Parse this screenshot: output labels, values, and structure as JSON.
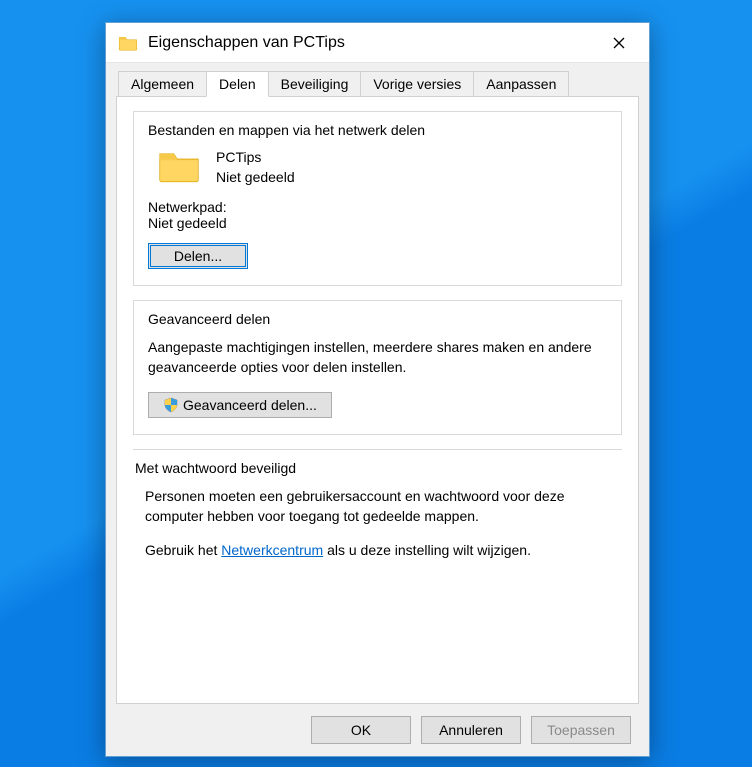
{
  "titlebar": {
    "title": "Eigenschappen van PCTips"
  },
  "tabs": {
    "algemeen": "Algemeen",
    "delen": "Delen",
    "beveiliging": "Beveiliging",
    "vorige": "Vorige versies",
    "aanpassen": "Aanpassen"
  },
  "section_share": {
    "heading": "Bestanden en mappen via het netwerk delen",
    "folder_name": "PCTips",
    "folder_status": "Niet gedeeld",
    "netpath_label": "Netwerkpad:",
    "netpath_value": "Niet gedeeld",
    "share_button": "Delen..."
  },
  "section_advanced": {
    "heading": "Geavanceerd delen",
    "description": "Aangepaste machtigingen instellen, meerdere shares maken en andere geavanceerde opties voor delen instellen.",
    "button": "Geavanceerd delen..."
  },
  "section_password": {
    "heading": "Met wachtwoord beveiligd",
    "line1": "Personen moeten een gebruikersaccount en wachtwoord voor deze computer hebben voor toegang tot gedeelde mappen.",
    "line2_pre": "Gebruik het ",
    "line2_link": "Netwerkcentrum",
    "line2_post": " als u deze instelling wilt wijzigen."
  },
  "footer": {
    "ok": "OK",
    "cancel": "Annuleren",
    "apply": "Toepassen"
  }
}
